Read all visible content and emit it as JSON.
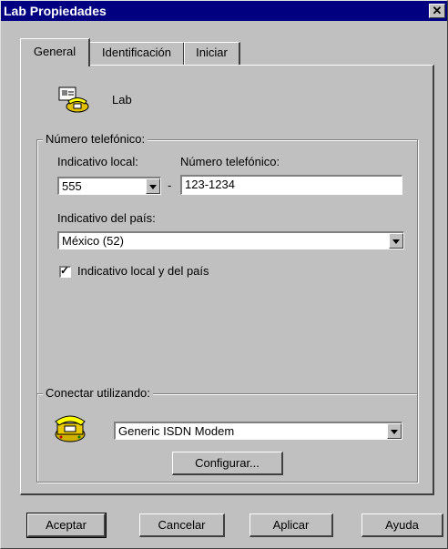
{
  "window": {
    "title": "Lab Propiedades",
    "close_glyph": "✕"
  },
  "tabs": [
    {
      "label": "General",
      "active": true
    },
    {
      "label": "Identificación",
      "active": false
    },
    {
      "label": "Iniciar",
      "active": false
    }
  ],
  "header": {
    "icon": "phone-card-icon",
    "name": "Lab"
  },
  "phone_group": {
    "legend": "Número telefónico:",
    "area_code_label": "Indicativo local:",
    "area_code_value": "555",
    "separator": "-",
    "phone_label": "Número telefónico:",
    "phone_value": "123-1234",
    "country_label": "Indicativo del país:",
    "country_value": "México (52)",
    "use_codes_label": "Indicativo local y del país",
    "use_codes_checked": true
  },
  "connect_group": {
    "legend": "Conectar utilizando:",
    "icon": "modem-telephone-icon",
    "modem_value": "Generic ISDN  Modem",
    "configure_label": "Configurar..."
  },
  "footer": {
    "ok_label": "Aceptar",
    "cancel_label": "Cancelar",
    "apply_label": "Aplicar",
    "help_label": "Ayuda"
  }
}
